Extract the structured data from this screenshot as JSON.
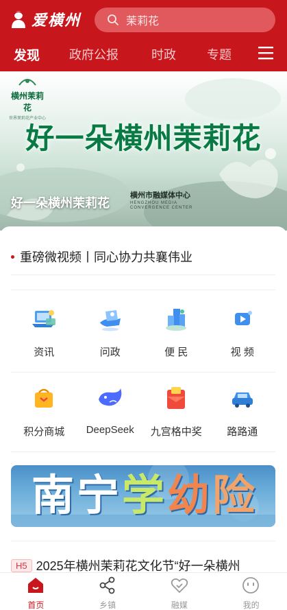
{
  "header": {
    "logo_text": "爱横州",
    "search_placeholder": "茉莉花",
    "nav": [
      "发现",
      "政府公报",
      "时政",
      "专题"
    ],
    "accent": "#c8161d"
  },
  "banner": {
    "logo_title": "横州茉莉花",
    "logo_sub": "世界茉莉花产业中心",
    "headline": "好一朵横州茉莉花",
    "caption": "好一朵横州茉莉花",
    "brand_cn": "横州市融媒体中心",
    "brand_en1": "HENGZHOU MEDIA",
    "brand_en2": "CONVERGENCE CENTER"
  },
  "headline": {
    "text": "重磅微视频丨同心协力共襄伟业"
  },
  "grid": {
    "row1": [
      {
        "label": "资讯",
        "icon": "news-laptop-icon"
      },
      {
        "label": "问政",
        "icon": "inquiry-hand-icon"
      },
      {
        "label": "便 民",
        "icon": "convenience-buildings-icon"
      },
      {
        "label": "视 频",
        "icon": "video-play-icon"
      }
    ],
    "row2": [
      {
        "label": "积分商城",
        "icon": "points-mall-bag-icon"
      },
      {
        "label": "DeepSeek",
        "icon": "deepseek-whale-icon"
      },
      {
        "label": "九宫格中奖",
        "icon": "lottery-envelope-icon"
      },
      {
        "label": "路路通",
        "icon": "car-traffic-icon"
      }
    ]
  },
  "promo": {
    "chars": [
      "南",
      "宁",
      "学",
      "幼",
      "险"
    ]
  },
  "news": {
    "tag": "H5",
    "title": "2025年横州茉莉花文化节“好一朵横州"
  },
  "tabbar": [
    {
      "label": "首页",
      "icon": "home-icon",
      "active": true
    },
    {
      "label": "乡镇",
      "icon": "share-network-icon",
      "active": false
    },
    {
      "label": "融媒",
      "icon": "heart-hand-icon",
      "active": false
    },
    {
      "label": "我的",
      "icon": "user-face-icon",
      "active": false
    }
  ]
}
